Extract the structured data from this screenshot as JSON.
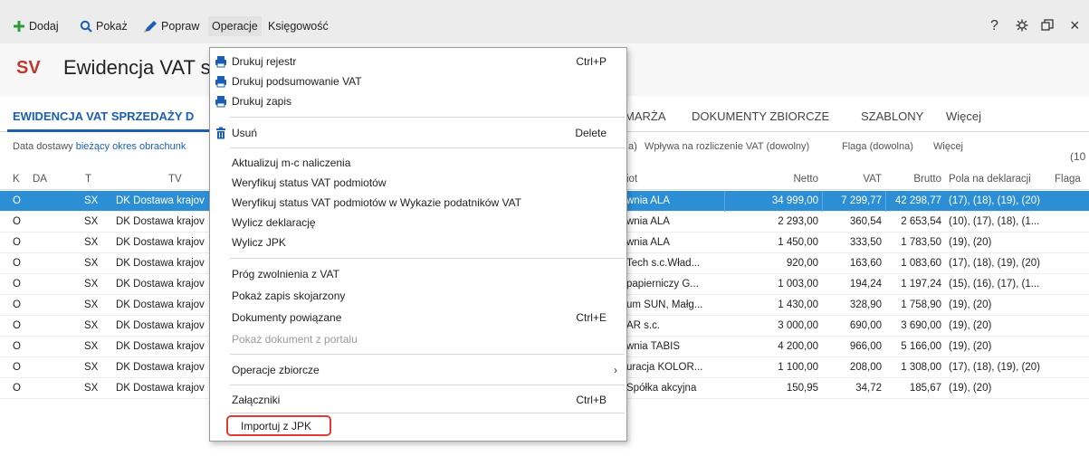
{
  "toolbar": {
    "add_label": "Dodaj",
    "show_label": "Pokaż",
    "edit_label": "Popraw",
    "operations_label": "Operacje",
    "accounting_label": "Księgowość",
    "help_icon": "?",
    "settings_icon": "gear-icon",
    "restore_icon": "restore-icon",
    "close_icon": "×"
  },
  "header": {
    "badge": "SV",
    "title": "Ewidencja VAT sp"
  },
  "tabs": {
    "main": "EWIDENCJA VAT SPRZEDAŻY D",
    "marza": "MARŻA",
    "dokumenty": "DOKUMENTY ZBIORCZE",
    "szablony": "SZABLONY",
    "wiecej": "Więcej"
  },
  "filters": {
    "date_prefix": "Data dostawy",
    "date_link": "bieżący okres obrachunk",
    "paren": "a)",
    "vat_flow": "Wpływa na rozliczenie VAT (dowolny)",
    "flag": "Flaga (dowolna)",
    "more": "Więcej",
    "count": "(10"
  },
  "columns": {
    "k": "K",
    "da": "DA",
    "t": "T",
    "tv": "TV",
    "podmiot": "iot",
    "netto": "Netto",
    "vat": "VAT",
    "brutto": "Brutto",
    "pola": "Pola na deklaracji",
    "flaga": "Flaga"
  },
  "rows": [
    {
      "k": "O",
      "t": "SX",
      "tv": "DK Dostawa krajov",
      "podmiot": "wnia ALA",
      "netto": "34 999,00",
      "vat": "7 299,77",
      "brutto": "42 298,77",
      "pola": "(17), (18), (19), (20)"
    },
    {
      "k": "O",
      "t": "SX",
      "tv": "DK Dostawa krajov",
      "podmiot": "wnia ALA",
      "netto": "2 293,00",
      "vat": "360,54",
      "brutto": "2 653,54",
      "pola": "(10), (17), (18), (1..."
    },
    {
      "k": "O",
      "t": "SX",
      "tv": "DK Dostawa krajov",
      "podmiot": "wnia ALA",
      "netto": "1 450,00",
      "vat": "333,50",
      "brutto": "1 783,50",
      "pola": "(19), (20)"
    },
    {
      "k": "O",
      "t": "SX",
      "tv": "DK Dostawa krajov",
      "podmiot": "Tech s.c.Wład...",
      "netto": "920,00",
      "vat": "163,60",
      "brutto": "1 083,60",
      "pola": "(17), (18), (19), (20)"
    },
    {
      "k": "O",
      "t": "SX",
      "tv": "DK Dostawa krajov",
      "podmiot": "papierniczy G...",
      "netto": "1 003,00",
      "vat": "194,24",
      "brutto": "1 197,24",
      "pola": "(15), (16), (17), (1..."
    },
    {
      "k": "O",
      "t": "SX",
      "tv": "DK Dostawa krajov",
      "podmiot": "um SUN, Małg...",
      "netto": "1 430,00",
      "vat": "328,90",
      "brutto": "1 758,90",
      "pola": "(19), (20)"
    },
    {
      "k": "O",
      "t": "SX",
      "tv": "DK Dostawa krajov",
      "podmiot": "AR s.c.",
      "netto": "3 000,00",
      "vat": "690,00",
      "brutto": "3 690,00",
      "pola": "(19), (20)"
    },
    {
      "k": "O",
      "t": "SX",
      "tv": "DK Dostawa krajov",
      "podmiot": "wnia TABIS",
      "netto": "4 200,00",
      "vat": "966,00",
      "brutto": "5 166,00",
      "pola": "(19), (20)"
    },
    {
      "k": "O",
      "t": "SX",
      "tv": "DK Dostawa krajov",
      "podmiot": "uracja KOLOR...",
      "netto": "1 100,00",
      "vat": "208,00",
      "brutto": "1 308,00",
      "pola": "(17), (18), (19), (20)"
    },
    {
      "k": "O",
      "t": "SX",
      "tv": "DK Dostawa krajov",
      "podmiot": "Spółka akcyjna",
      "netto": "150,95",
      "vat": "34,72",
      "brutto": "185,67",
      "pola": "(19), (20)"
    }
  ],
  "menu": {
    "print_register": "Drukuj rejestr",
    "print_register_shortcut": "Ctrl+P",
    "print_vat_summary": "Drukuj podsumowanie VAT",
    "print_record": "Drukuj zapis",
    "delete": "Usuń",
    "delete_shortcut": "Delete",
    "update_month": "Aktualizuj m-c naliczenia",
    "verify_vat_status": "Weryfikuj status VAT podmiotów",
    "verify_vat_status_list": "Weryfikuj status VAT podmiotów w Wykazie podatników VAT",
    "calc_declaration": "Wylicz deklarację",
    "calc_jpk": "Wylicz JPK",
    "vat_threshold": "Próg zwolnienia z VAT",
    "show_linked_record": "Pokaż zapis skojarzony",
    "related_docs": "Dokumenty powiązane",
    "related_docs_shortcut": "Ctrl+E",
    "show_portal_doc": "Pokaż dokument z portalu",
    "bulk_operations": "Operacje zbiorcze",
    "attachments": "Załączniki",
    "attachments_shortcut": "Ctrl+B",
    "import_jpk": "Importuj z JPK"
  },
  "colors": {
    "accent": "#1a5fb4",
    "selected_row": "#2c8fd6",
    "badge": "#c0392b",
    "highlight": "#e53935",
    "add_icon": "#2e9b3a"
  }
}
